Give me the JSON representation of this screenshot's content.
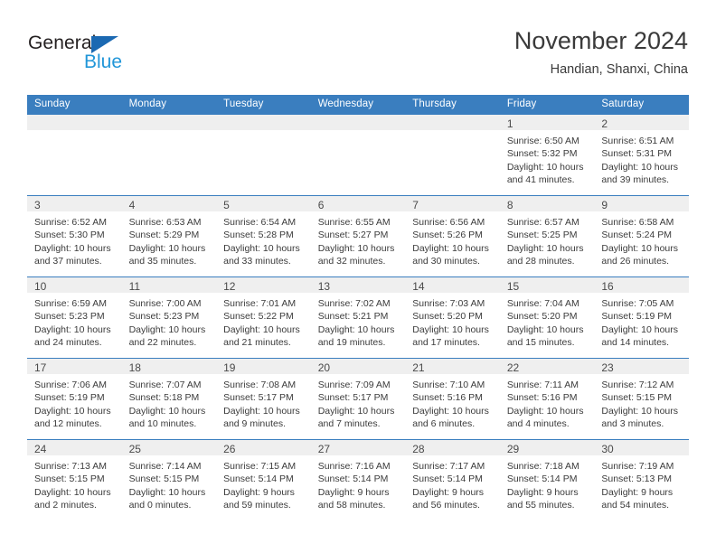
{
  "brand": {
    "name_part1": "General",
    "name_part2": "Blue"
  },
  "header": {
    "title": "November 2024",
    "subtitle": "Handian, Shanxi, China"
  },
  "colors": {
    "header_blue": "#3a7ebf",
    "logo_blue": "#2196d8",
    "logo_triangle": "#1b69b2",
    "daynum_band": "#efefef",
    "text": "#3b3b3b"
  },
  "weekdays": [
    "Sunday",
    "Monday",
    "Tuesday",
    "Wednesday",
    "Thursday",
    "Friday",
    "Saturday"
  ],
  "weeks": [
    [
      {
        "day": "",
        "empty": true
      },
      {
        "day": "",
        "empty": true
      },
      {
        "day": "",
        "empty": true
      },
      {
        "day": "",
        "empty": true
      },
      {
        "day": "",
        "empty": true
      },
      {
        "day": "1",
        "sunrise": "Sunrise: 6:50 AM",
        "sunset": "Sunset: 5:32 PM",
        "daylight1": "Daylight: 10 hours",
        "daylight2": "and 41 minutes."
      },
      {
        "day": "2",
        "sunrise": "Sunrise: 6:51 AM",
        "sunset": "Sunset: 5:31 PM",
        "daylight1": "Daylight: 10 hours",
        "daylight2": "and 39 minutes."
      }
    ],
    [
      {
        "day": "3",
        "sunrise": "Sunrise: 6:52 AM",
        "sunset": "Sunset: 5:30 PM",
        "daylight1": "Daylight: 10 hours",
        "daylight2": "and 37 minutes."
      },
      {
        "day": "4",
        "sunrise": "Sunrise: 6:53 AM",
        "sunset": "Sunset: 5:29 PM",
        "daylight1": "Daylight: 10 hours",
        "daylight2": "and 35 minutes."
      },
      {
        "day": "5",
        "sunrise": "Sunrise: 6:54 AM",
        "sunset": "Sunset: 5:28 PM",
        "daylight1": "Daylight: 10 hours",
        "daylight2": "and 33 minutes."
      },
      {
        "day": "6",
        "sunrise": "Sunrise: 6:55 AM",
        "sunset": "Sunset: 5:27 PM",
        "daylight1": "Daylight: 10 hours",
        "daylight2": "and 32 minutes."
      },
      {
        "day": "7",
        "sunrise": "Sunrise: 6:56 AM",
        "sunset": "Sunset: 5:26 PM",
        "daylight1": "Daylight: 10 hours",
        "daylight2": "and 30 minutes."
      },
      {
        "day": "8",
        "sunrise": "Sunrise: 6:57 AM",
        "sunset": "Sunset: 5:25 PM",
        "daylight1": "Daylight: 10 hours",
        "daylight2": "and 28 minutes."
      },
      {
        "day": "9",
        "sunrise": "Sunrise: 6:58 AM",
        "sunset": "Sunset: 5:24 PM",
        "daylight1": "Daylight: 10 hours",
        "daylight2": "and 26 minutes."
      }
    ],
    [
      {
        "day": "10",
        "sunrise": "Sunrise: 6:59 AM",
        "sunset": "Sunset: 5:23 PM",
        "daylight1": "Daylight: 10 hours",
        "daylight2": "and 24 minutes."
      },
      {
        "day": "11",
        "sunrise": "Sunrise: 7:00 AM",
        "sunset": "Sunset: 5:23 PM",
        "daylight1": "Daylight: 10 hours",
        "daylight2": "and 22 minutes."
      },
      {
        "day": "12",
        "sunrise": "Sunrise: 7:01 AM",
        "sunset": "Sunset: 5:22 PM",
        "daylight1": "Daylight: 10 hours",
        "daylight2": "and 21 minutes."
      },
      {
        "day": "13",
        "sunrise": "Sunrise: 7:02 AM",
        "sunset": "Sunset: 5:21 PM",
        "daylight1": "Daylight: 10 hours",
        "daylight2": "and 19 minutes."
      },
      {
        "day": "14",
        "sunrise": "Sunrise: 7:03 AM",
        "sunset": "Sunset: 5:20 PM",
        "daylight1": "Daylight: 10 hours",
        "daylight2": "and 17 minutes."
      },
      {
        "day": "15",
        "sunrise": "Sunrise: 7:04 AM",
        "sunset": "Sunset: 5:20 PM",
        "daylight1": "Daylight: 10 hours",
        "daylight2": "and 15 minutes."
      },
      {
        "day": "16",
        "sunrise": "Sunrise: 7:05 AM",
        "sunset": "Sunset: 5:19 PM",
        "daylight1": "Daylight: 10 hours",
        "daylight2": "and 14 minutes."
      }
    ],
    [
      {
        "day": "17",
        "sunrise": "Sunrise: 7:06 AM",
        "sunset": "Sunset: 5:19 PM",
        "daylight1": "Daylight: 10 hours",
        "daylight2": "and 12 minutes."
      },
      {
        "day": "18",
        "sunrise": "Sunrise: 7:07 AM",
        "sunset": "Sunset: 5:18 PM",
        "daylight1": "Daylight: 10 hours",
        "daylight2": "and 10 minutes."
      },
      {
        "day": "19",
        "sunrise": "Sunrise: 7:08 AM",
        "sunset": "Sunset: 5:17 PM",
        "daylight1": "Daylight: 10 hours",
        "daylight2": "and 9 minutes."
      },
      {
        "day": "20",
        "sunrise": "Sunrise: 7:09 AM",
        "sunset": "Sunset: 5:17 PM",
        "daylight1": "Daylight: 10 hours",
        "daylight2": "and 7 minutes."
      },
      {
        "day": "21",
        "sunrise": "Sunrise: 7:10 AM",
        "sunset": "Sunset: 5:16 PM",
        "daylight1": "Daylight: 10 hours",
        "daylight2": "and 6 minutes."
      },
      {
        "day": "22",
        "sunrise": "Sunrise: 7:11 AM",
        "sunset": "Sunset: 5:16 PM",
        "daylight1": "Daylight: 10 hours",
        "daylight2": "and 4 minutes."
      },
      {
        "day": "23",
        "sunrise": "Sunrise: 7:12 AM",
        "sunset": "Sunset: 5:15 PM",
        "daylight1": "Daylight: 10 hours",
        "daylight2": "and 3 minutes."
      }
    ],
    [
      {
        "day": "24",
        "sunrise": "Sunrise: 7:13 AM",
        "sunset": "Sunset: 5:15 PM",
        "daylight1": "Daylight: 10 hours",
        "daylight2": "and 2 minutes."
      },
      {
        "day": "25",
        "sunrise": "Sunrise: 7:14 AM",
        "sunset": "Sunset: 5:15 PM",
        "daylight1": "Daylight: 10 hours",
        "daylight2": "and 0 minutes."
      },
      {
        "day": "26",
        "sunrise": "Sunrise: 7:15 AM",
        "sunset": "Sunset: 5:14 PM",
        "daylight1": "Daylight: 9 hours",
        "daylight2": "and 59 minutes."
      },
      {
        "day": "27",
        "sunrise": "Sunrise: 7:16 AM",
        "sunset": "Sunset: 5:14 PM",
        "daylight1": "Daylight: 9 hours",
        "daylight2": "and 58 minutes."
      },
      {
        "day": "28",
        "sunrise": "Sunrise: 7:17 AM",
        "sunset": "Sunset: 5:14 PM",
        "daylight1": "Daylight: 9 hours",
        "daylight2": "and 56 minutes."
      },
      {
        "day": "29",
        "sunrise": "Sunrise: 7:18 AM",
        "sunset": "Sunset: 5:14 PM",
        "daylight1": "Daylight: 9 hours",
        "daylight2": "and 55 minutes."
      },
      {
        "day": "30",
        "sunrise": "Sunrise: 7:19 AM",
        "sunset": "Sunset: 5:13 PM",
        "daylight1": "Daylight: 9 hours",
        "daylight2": "and 54 minutes."
      }
    ]
  ]
}
